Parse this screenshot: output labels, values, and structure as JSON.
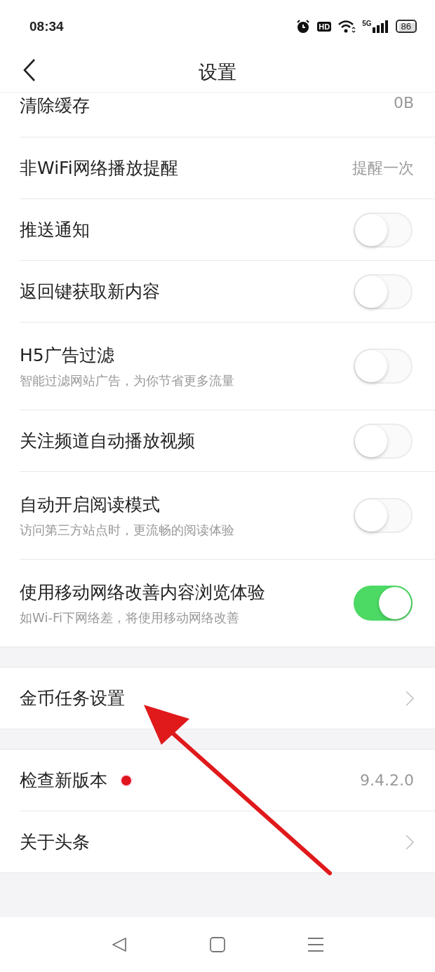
{
  "status_bar": {
    "time": "08:34",
    "hd": "HD",
    "network": "5G",
    "battery": "86"
  },
  "header": {
    "back": true,
    "title": "设置"
  },
  "sections": [
    {
      "items": [
        {
          "kind": "value",
          "label": "清除缓存",
          "value": "0B",
          "cut": true
        },
        {
          "kind": "value",
          "label": "非WiFi网络播放提醒",
          "value": "提醒一次"
        },
        {
          "kind": "toggle",
          "label": "推送通知",
          "on": false
        },
        {
          "kind": "toggle",
          "label": "返回键获取新内容",
          "on": false
        },
        {
          "kind": "toggle",
          "label": "H5广告过滤",
          "subtitle": "智能过滤网站广告，为你节省更多流量",
          "on": false
        },
        {
          "kind": "toggle",
          "label": "关注频道自动播放视频",
          "on": false
        },
        {
          "kind": "toggle",
          "label": "自动开启阅读模式",
          "subtitle": "访问第三方站点时，更流畅的阅读体验",
          "on": false
        },
        {
          "kind": "toggle",
          "label": "使用移动网络改善内容浏览体验",
          "subtitle": "如Wi-Fi下网络差，将使用移动网络改善",
          "on": true
        }
      ]
    },
    {
      "items": [
        {
          "kind": "chevron",
          "label": "金币任务设置"
        }
      ]
    },
    {
      "items": [
        {
          "kind": "value",
          "label": "检查新版本",
          "value": "9.4.2.0",
          "dot": true
        },
        {
          "kind": "chevron",
          "label": "关于头条"
        }
      ]
    }
  ],
  "annotation": {
    "kind": "arrow"
  }
}
